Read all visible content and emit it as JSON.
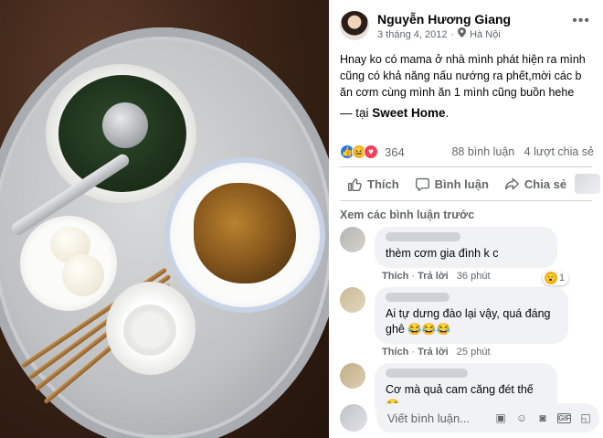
{
  "post": {
    "author": "Nguyễn Hương Giang",
    "date": "3 tháng 4, 2012",
    "separator": "·",
    "location": "Hà Nội",
    "more_icon": "more-icon",
    "text": "Hnay ko có mama ở nhà mình phát hiện ra mình cũng có khả năng nấu nướng ra phết,mời các b ăn cơm cùng mình ăn 1 mình cũng buồn hehe",
    "at_prefix": "— tại ",
    "place": "Sweet Home",
    "at_suffix": "."
  },
  "stats": {
    "reaction_count": "364",
    "comments": "88 bình luận",
    "shares": "4 lượt chia sẻ",
    "reaction_types": [
      "like",
      "haha",
      "love"
    ]
  },
  "actions": {
    "like": "Thích",
    "comment": "Bình luận",
    "share": "Chia sẻ"
  },
  "comments_section": {
    "previous": "Xem các bình luận trước",
    "items": [
      {
        "text": "thèm cơm gia đình k c",
        "like": "Thích",
        "reply": "Trả lời",
        "time": "36 phút",
        "reaction_count": "1"
      },
      {
        "text": "Ai tự dưng đào lại vậy, quá đáng ghê 😂😂😂",
        "like": "Thích",
        "reply": "Trả lời",
        "time": "25 phút"
      },
      {
        "text": "Cơ mà quả cam căng đét thế 😂"
      }
    ]
  },
  "composer": {
    "placeholder": "Viết bình luận...",
    "icons": [
      "sticker-icon",
      "emoji-icon",
      "camera-icon",
      "gif-icon",
      "sticker2-icon"
    ]
  },
  "colors": {
    "accent": "#2078f4",
    "muted": "#65676b",
    "bubble": "#f0f2f5"
  }
}
